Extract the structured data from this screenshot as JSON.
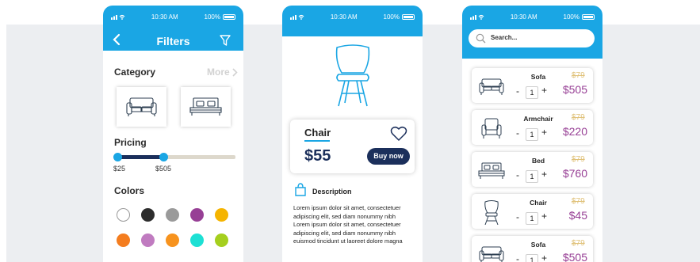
{
  "status": {
    "time": "10:30 AM",
    "battery": "100%"
  },
  "filters": {
    "title": "Filters",
    "category_label": "Category",
    "more_label": "More",
    "pricing_label": "Pricing",
    "price_min": "$25",
    "price_max": "$505",
    "colors_label": "Colors",
    "swatches": [
      "#ffffff",
      "#2d2d2d",
      "#9a9a9a",
      "#973f95",
      "#f5b400",
      "#f47d1f",
      "#c07bc0",
      "#f7931e",
      "#1de0d4",
      "#a5cf1e"
    ]
  },
  "product": {
    "name": "Chair",
    "price": "$55",
    "buy_label": "Buy now",
    "description_label": "Description",
    "description_lines": [
      "Lorem ipsum dolor sit amet, consectetuer",
      "adipiscing elit, sed diam nonummy nibh",
      "Lorem ipsum dolor sit amet, consectetuer",
      "adipiscing elit, sed diam nonummy nibh",
      "euismod tincidunt ut laoreet dolore magna"
    ]
  },
  "cart": {
    "search_placeholder": "Search...",
    "items": [
      {
        "name": "Sofa",
        "icon": "sofa-icon",
        "old_price": "$79",
        "price": "$505",
        "qty": "1"
      },
      {
        "name": "Armchair",
        "icon": "armchair-icon",
        "old_price": "$79",
        "price": "$220",
        "qty": "1"
      },
      {
        "name": "Bed",
        "icon": "bed-icon",
        "old_price": "$79",
        "price": "$760",
        "qty": "1"
      },
      {
        "name": "Chair",
        "icon": "chair-icon",
        "old_price": "$79",
        "price": "$45",
        "qty": "1"
      },
      {
        "name": "Sofa",
        "icon": "sofa-icon",
        "old_price": "$79",
        "price": "$505",
        "qty": "1"
      }
    ],
    "minus": "-",
    "plus": "+"
  },
  "colors": {
    "accent": "#1aa6e4",
    "navy": "#1b2f5b",
    "purple": "#973f95"
  }
}
